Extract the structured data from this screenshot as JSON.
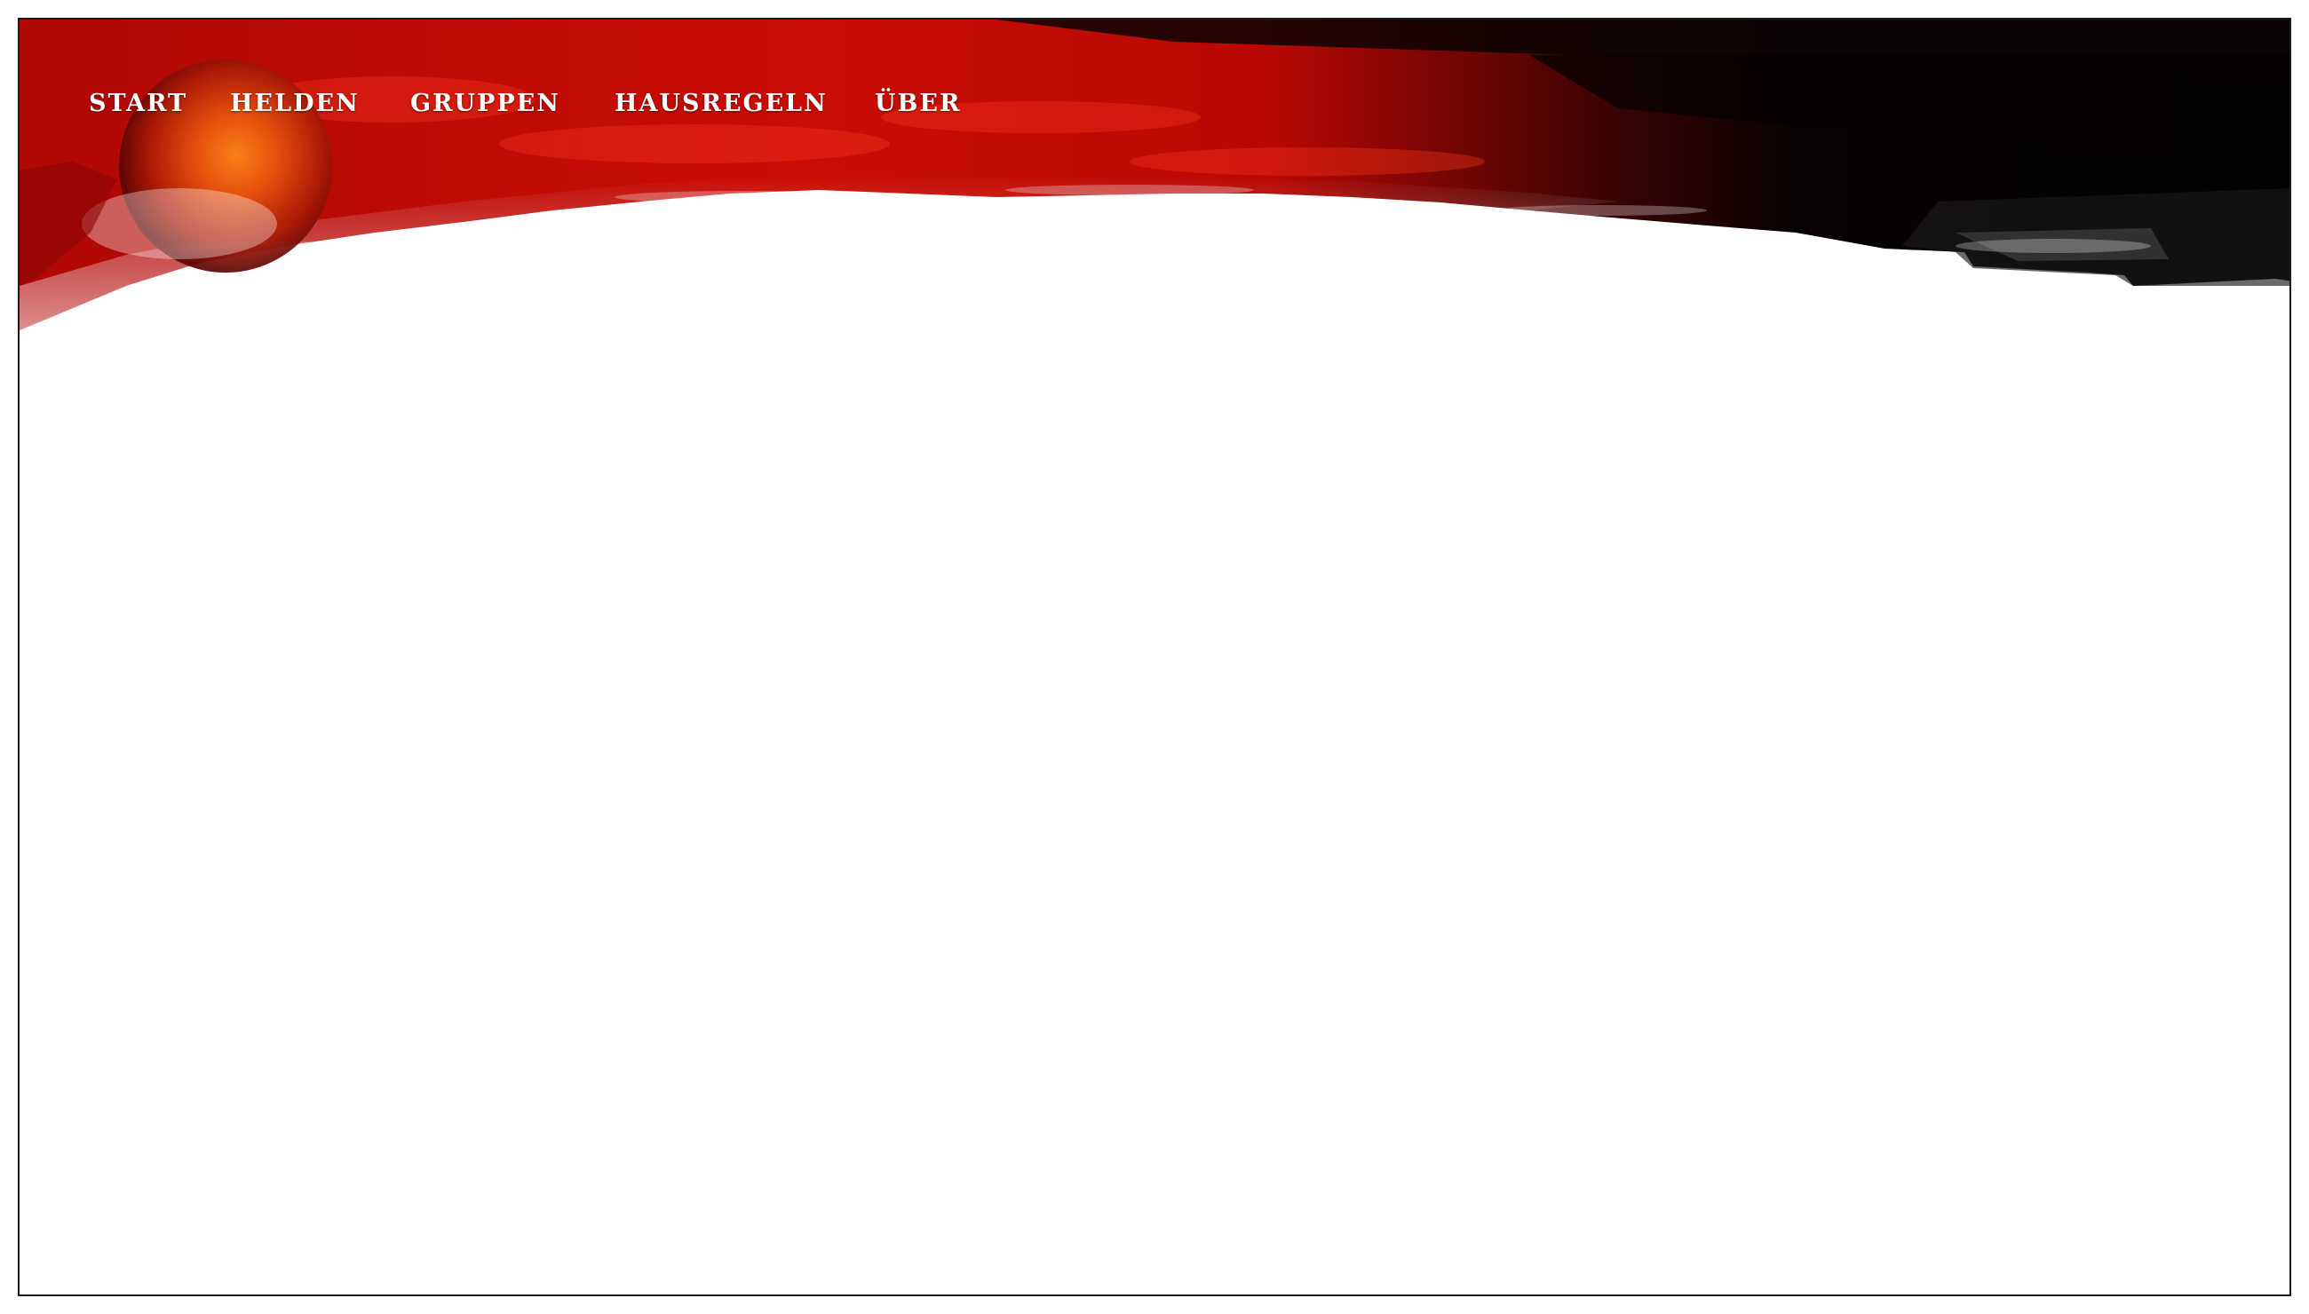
{
  "nav": {
    "items": [
      {
        "label": "START",
        "active": true
      },
      {
        "label": "HELDEN",
        "active": false
      },
      {
        "label": "GRUPPEN",
        "active": false
      },
      {
        "label": "HAUSREGELN",
        "active": false
      },
      {
        "label": "ÜBER",
        "active": false
      }
    ]
  },
  "colors": {
    "banner_red": "#c40a04",
    "banner_dark": "#050505",
    "sun_orange": "#e8560e",
    "nav_text": "#ffffff",
    "background": "#ffffff"
  }
}
